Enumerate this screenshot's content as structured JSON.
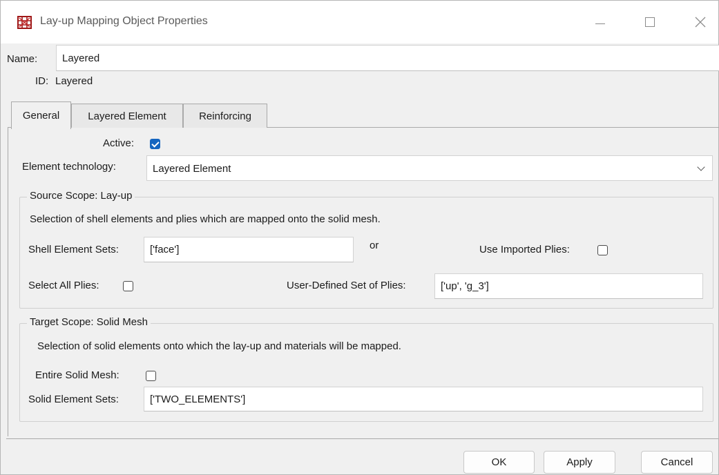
{
  "window": {
    "title": "Lay-up Mapping Object Properties",
    "icon": "app-mesh-icon",
    "controls": [
      "minimize-icon",
      "maximize-icon",
      "close-icon"
    ]
  },
  "name": {
    "label": "Name:",
    "value": "Layered"
  },
  "id": {
    "label": "ID:",
    "value": "Layered"
  },
  "tabs": [
    {
      "label": "General",
      "active": true
    },
    {
      "label": "Layered Element",
      "active": false
    },
    {
      "label": "Reinforcing",
      "active": false
    }
  ],
  "general": {
    "active": {
      "label": "Active:",
      "checked": true
    },
    "element_technology": {
      "label": "Element technology:",
      "value": "Layered Element"
    },
    "source_scope": {
      "title": "Source Scope: Lay-up",
      "description": "Selection of shell elements and plies which are mapped onto the solid mesh.",
      "shell_element_sets": {
        "label": "Shell Element Sets:",
        "value": "['face']"
      },
      "or_text": "or",
      "use_imported_plies": {
        "label": "Use Imported Plies:",
        "checked": false
      },
      "select_all_plies": {
        "label": "Select All Plies:",
        "checked": false
      },
      "user_defined_plies": {
        "label": "User-Defined Set of Plies:",
        "value": "['up', 'g_3']"
      }
    },
    "target_scope": {
      "title": "Target Scope: Solid Mesh",
      "description": "Selection of solid elements onto which the lay-up and materials will be mapped.",
      "entire_solid_mesh": {
        "label": "Entire Solid Mesh:",
        "checked": false
      },
      "solid_element_sets": {
        "label": "Solid Element Sets:",
        "value": "['TWO_ELEMENTS']"
      }
    }
  },
  "buttons": {
    "ok": "OK",
    "apply": "Apply",
    "cancel": "Cancel"
  },
  "colors": {
    "accent": "#1565c0",
    "window_bg": "#f0f0f0"
  }
}
